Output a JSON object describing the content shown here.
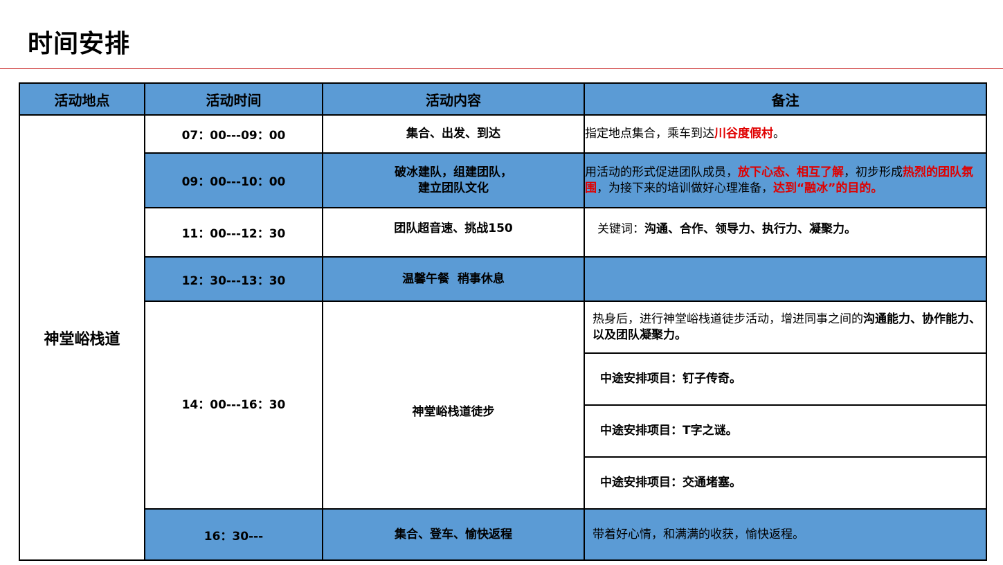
{
  "page": {
    "title": "时间安排"
  },
  "table": {
    "headers": [
      "活动地点",
      "活动时间",
      "活动内容",
      "备注"
    ],
    "location": "神堂峪栈道",
    "rows": [
      {
        "time": "07：00---09：00",
        "content": "集合、出发、到达",
        "note": {
          "pre": "指定地点集合，乘车到达",
          "red": "川谷度假村",
          "post": "。"
        }
      },
      {
        "time": "09：00---10：00",
        "content_line1": "破冰建队，组建团队，",
        "content_line2": "建立团队文化",
        "note": {
          "p1": "用活动的形式促进团队成员，",
          "r1": "放下心态、相互了解",
          "p2": "，初步形成",
          "r2": "热烈的团队氛围",
          "p3": "，为接下来的培训做好心理准备，",
          "r3": "达到“融冰”的目的。"
        }
      },
      {
        "time": "11：00---12：30",
        "content": "团队超音速、挑战150",
        "note": {
          "pre": "关键词：",
          "bold": "沟通、合作、领导力、执行力、凝聚力。"
        }
      },
      {
        "time": "12：30---13：30",
        "content": "温馨午餐  稍事休息",
        "note": ""
      },
      {
        "time": "14：00---16：30",
        "content": "神堂峪栈道徒步",
        "notes": {
          "n1_pre": "热身后，进行神堂峪栈道徒步活动，增进同事之间的",
          "n1_bold": "沟通能力、协作能力、以及团队凝聚力。",
          "n2": "中途安排项目：钉子传奇。",
          "n3": "中途安排项目：T字之谜。",
          "n4": "中途安排项目：交通堵塞。"
        }
      },
      {
        "time": "16：30---",
        "content": "集合、登车、愉快返程",
        "note": "带着好心情，和满满的收获，愉快返程。"
      }
    ]
  }
}
